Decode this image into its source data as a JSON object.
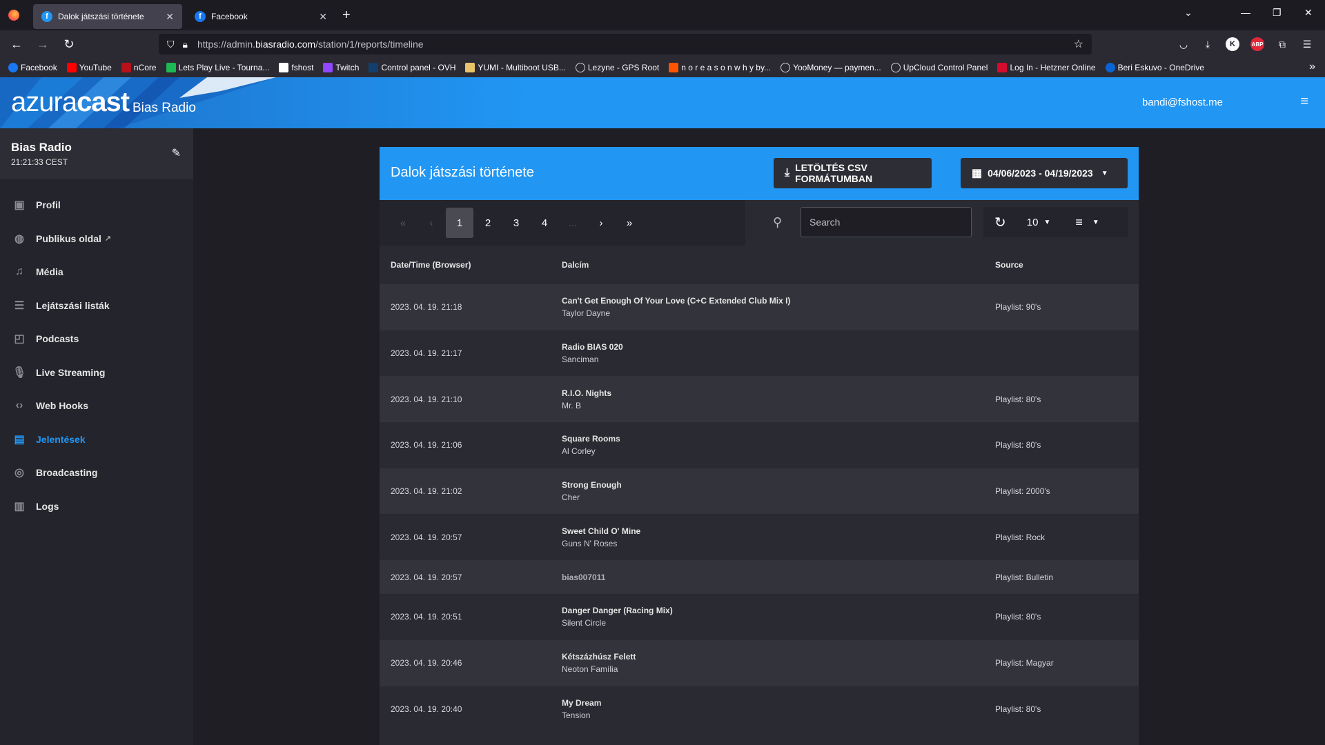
{
  "browser": {
    "tabs": [
      {
        "title": "Dalok játszási története",
        "active": true
      },
      {
        "title": "Facebook",
        "active": false
      }
    ],
    "url_prefix": "https://admin.",
    "url_domain": "biasradio.com",
    "url_path": "/station/1/reports/timeline",
    "bookmarks": [
      {
        "label": "Facebook",
        "color": "#1877f2"
      },
      {
        "label": "YouTube",
        "color": "#ff0000"
      },
      {
        "label": "nCore",
        "color": "#b5121b"
      },
      {
        "label": "Lets Play Live - Tourna...",
        "color": "#1db954"
      },
      {
        "label": "fshost",
        "color": "#ffffff"
      },
      {
        "label": "Twitch",
        "color": "#9146ff"
      },
      {
        "label": "Control panel - OVH",
        "color": "#123f6d"
      },
      {
        "label": "YUMI - Multiboot USB...",
        "color": "#e8c36a"
      },
      {
        "label": "Lezyne - GPS Root",
        "color": "#cfcfd8"
      },
      {
        "label": "n o r e a s o n w h y by...",
        "color": "#ff5500"
      },
      {
        "label": "YooMoney — paymen...",
        "color": "#cfcfd8"
      },
      {
        "label": "UpCloud Control Panel",
        "color": "#cfcfd8"
      },
      {
        "label": "Log In - Hetzner Online",
        "color": "#d50c2d"
      },
      {
        "label": "Beri Eskuvo - OneDrive",
        "color": "#0a64d6"
      }
    ]
  },
  "header": {
    "brand_light": "azura",
    "brand_bold": "cast",
    "station": "Bias Radio",
    "user_email": "bandi@fshost.me"
  },
  "sidebar": {
    "station_name": "Bias Radio",
    "station_time": "21:21:33 CEST",
    "items": [
      {
        "label": "Profil",
        "icon": "image-icon"
      },
      {
        "label": "Publikus oldal",
        "icon": "globe-icon"
      },
      {
        "label": "Média",
        "icon": "library-music-icon"
      },
      {
        "label": "Lejátszási listák",
        "icon": "queue-music-icon"
      },
      {
        "label": "Podcasts",
        "icon": "cast-icon"
      },
      {
        "label": "Live Streaming",
        "icon": "mic-icon"
      },
      {
        "label": "Web Hooks",
        "icon": "code-icon"
      },
      {
        "label": "Jelentések",
        "icon": "assignment-icon"
      },
      {
        "label": "Broadcasting",
        "icon": "podcast-icon"
      },
      {
        "label": "Logs",
        "icon": "logs-icon"
      }
    ]
  },
  "card": {
    "title": "Dalok játszási története",
    "csv_button": "LETÖLTÉS CSV FORMÁTUMBAN",
    "date_range": "04/06/2023 - 04/19/2023",
    "pagination": [
      "«",
      "‹",
      "1",
      "2",
      "3",
      "4",
      "...",
      "›",
      "»"
    ],
    "search_placeholder": "Search",
    "page_size": "10",
    "columns": [
      "Date/Time (Browser)",
      "Dalcím",
      "Source"
    ],
    "rows": [
      {
        "datetime": "2023. 04. 19. 21:18",
        "title": "Can't Get Enough Of Your Love (C+C Extended Club Mix I)",
        "artist": "Taylor Dayne",
        "source": "Playlist: 90's"
      },
      {
        "datetime": "2023. 04. 19. 21:17",
        "title": "Radio BIAS 020",
        "artist": "Sanciman",
        "source": ""
      },
      {
        "datetime": "2023. 04. 19. 21:10",
        "title": "R.I.O. Nights",
        "artist": "Mr. B",
        "source": "Playlist: 80's"
      },
      {
        "datetime": "2023. 04. 19. 21:06",
        "title": "Square Rooms",
        "artist": "Al Corley",
        "source": "Playlist: 80's"
      },
      {
        "datetime": "2023. 04. 19. 21:02",
        "title": "Strong Enough",
        "artist": "Cher",
        "source": "Playlist: 2000's"
      },
      {
        "datetime": "2023. 04. 19. 20:57",
        "title": "Sweet Child O' Mine",
        "artist": "Guns N' Roses",
        "source": "Playlist: Rock"
      },
      {
        "datetime": "2023. 04. 19. 20:57",
        "title": "bias007011",
        "artist": "",
        "source": "Playlist: Bulletin"
      },
      {
        "datetime": "2023. 04. 19. 20:51",
        "title": "Danger Danger (Racing Mix)",
        "artist": "Silent Circle",
        "source": "Playlist: 80's"
      },
      {
        "datetime": "2023. 04. 19. 20:46",
        "title": "Kétszázhúsz Felett",
        "artist": "Neoton Família",
        "source": "Playlist: Magyar"
      },
      {
        "datetime": "2023. 04. 19. 20:40",
        "title": "My Dream",
        "artist": "Tension",
        "source": "Playlist: 80's"
      }
    ]
  },
  "colors": {
    "accent": "#2196f3",
    "sidebar_bg": "#24242c",
    "card_bg": "#2a2a32"
  }
}
